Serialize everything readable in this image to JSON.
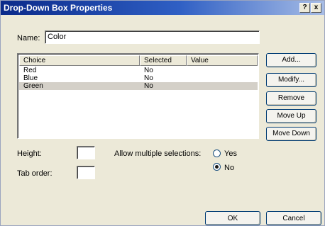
{
  "window": {
    "title": "Drop-Down Box Properties",
    "help_button": "?",
    "close_button": "x"
  },
  "name_field": {
    "label": "Name:",
    "value": "Color"
  },
  "choices": {
    "headers": [
      "Choice",
      "Selected",
      "Value"
    ],
    "rows": [
      {
        "choice": "Red",
        "selected": "No",
        "value": "",
        "highlighted": false
      },
      {
        "choice": "Blue",
        "selected": "No",
        "value": "",
        "highlighted": false
      },
      {
        "choice": "Green",
        "selected": "No",
        "value": "",
        "highlighted": true
      }
    ]
  },
  "buttons": {
    "add": "Add...",
    "modify": "Modify...",
    "remove": "Remove",
    "move_up": "Move Up",
    "move_down": "Move Down",
    "ok": "OK",
    "cancel": "Cancel"
  },
  "height_field": {
    "label": "Height:",
    "value": ""
  },
  "tab_order_field": {
    "label": "Tab order:",
    "value": ""
  },
  "multiple_selections": {
    "label": "Allow multiple selections:",
    "options": [
      {
        "label": "Yes",
        "checked": false
      },
      {
        "label": "No",
        "checked": true
      }
    ]
  },
  "colors": {
    "title_bar_start": "#0a2a8a",
    "title_bar_end": "#a7bde6",
    "dialog_background": "#ece9d8",
    "selected_row": "#d4d0c8"
  }
}
